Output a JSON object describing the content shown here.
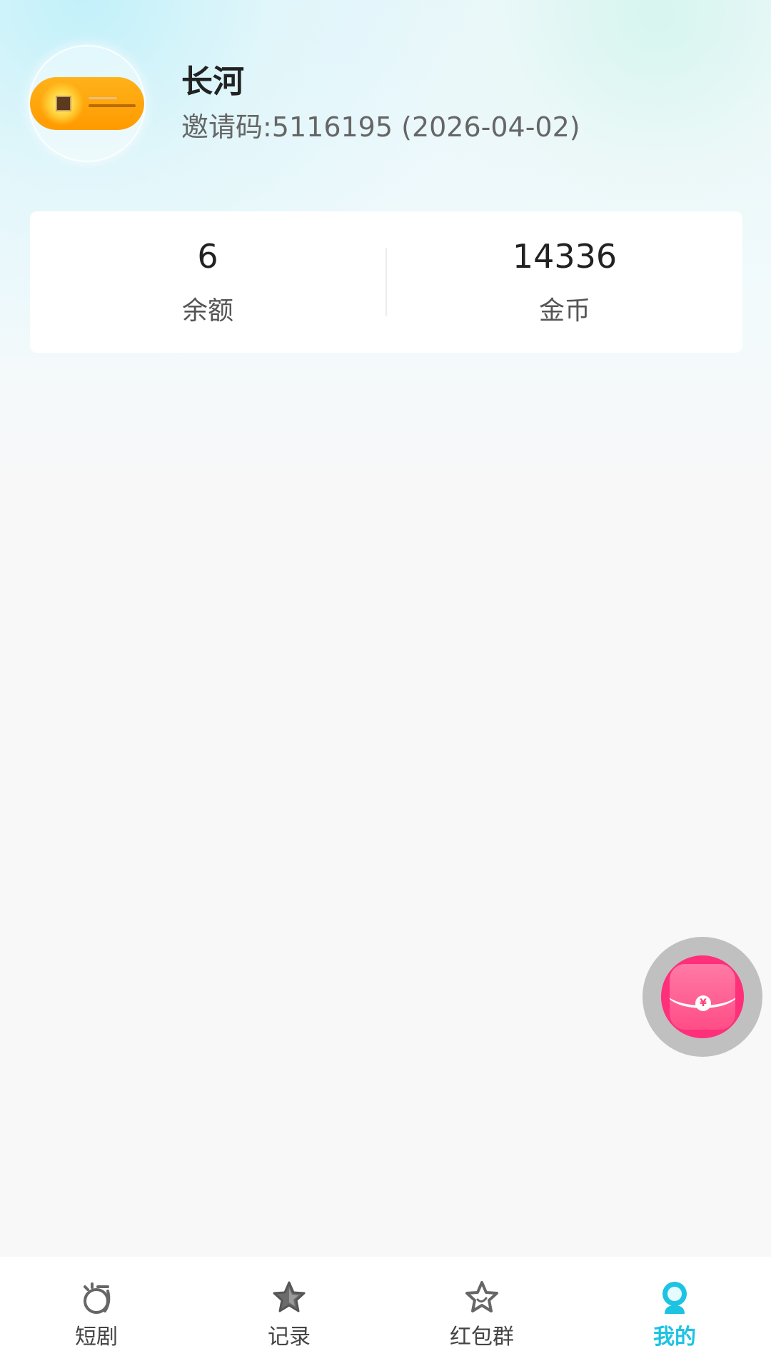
{
  "profile": {
    "username": "长河",
    "invite_text": "邀请码:5116195 (2026-04-02)"
  },
  "stats": [
    {
      "value": "6",
      "label": "余额"
    },
    {
      "value": "14336",
      "label": "金币"
    }
  ],
  "float_button": {
    "icon": "red-packet-icon",
    "seal_text": "¥"
  },
  "bottom_nav": {
    "items": [
      {
        "label": "短剧",
        "icon": "drama-icon",
        "active": false
      },
      {
        "label": "记录",
        "icon": "star-filled-icon",
        "active": false
      },
      {
        "label": "红包群",
        "icon": "star-outline-icon",
        "active": false
      },
      {
        "label": "我的",
        "icon": "profile-icon",
        "active": true
      }
    ],
    "active_color": "#1cc3e3",
    "inactive_color": "#444444"
  }
}
